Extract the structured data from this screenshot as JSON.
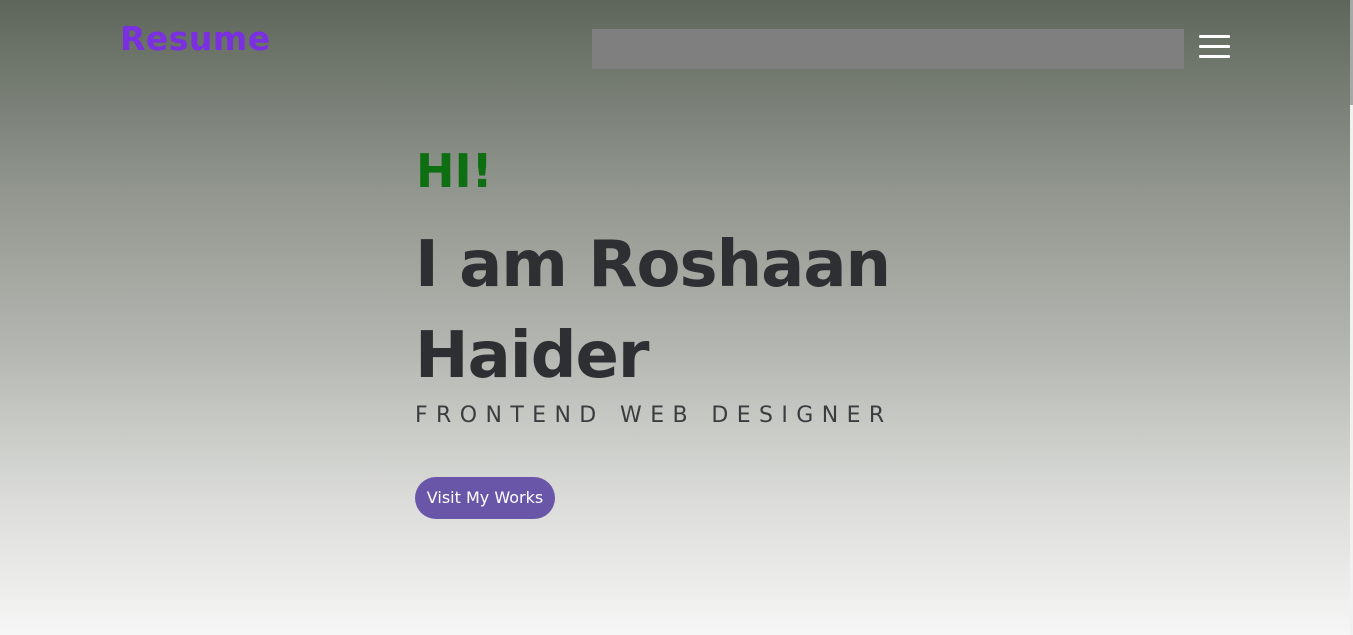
{
  "header": {
    "logo": "Resume",
    "search": {
      "value": "",
      "placeholder": ""
    },
    "menu_icon": "hamburger-menu-icon"
  },
  "hero": {
    "greeting": "HI!",
    "name": "I am Roshaan Haider",
    "role": "FRONTEND WEB DESIGNER",
    "cta_label": "Visit My Works"
  },
  "colors": {
    "logo": "#7a2fe0",
    "greeting": "#0e6e12",
    "name": "#2d2f32",
    "button": "#6a56a8",
    "search_bar": "#7f7f7f"
  }
}
